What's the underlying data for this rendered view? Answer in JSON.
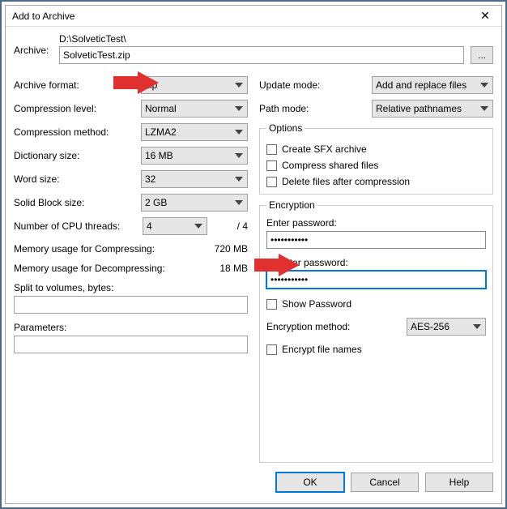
{
  "title": "Add to Archive",
  "archive": {
    "label": "Archive:",
    "path": "D:\\SolveticTest\\",
    "name": "SolveticTest.zip",
    "browse": "..."
  },
  "left": {
    "format_lbl": "Archive format:",
    "format_val": "zip",
    "level_lbl": "Compression level:",
    "level_val": "Normal",
    "method_lbl": "Compression method:",
    "method_val": "LZMA2",
    "dict_lbl": "Dictionary size:",
    "dict_val": "16 MB",
    "word_lbl": "Word size:",
    "word_val": "32",
    "block_lbl": "Solid Block size:",
    "block_val": "2 GB",
    "cpu_lbl": "Number of CPU threads:",
    "cpu_val": "4",
    "cpu_total": "/ 4",
    "mem_comp_lbl": "Memory usage for Compressing:",
    "mem_comp_val": "720 MB",
    "mem_decomp_lbl": "Memory usage for Decompressing:",
    "mem_decomp_val": "18 MB",
    "split_lbl": "Split to volumes, bytes:",
    "split_val": "",
    "params_lbl": "Parameters:",
    "params_val": ""
  },
  "right": {
    "update_lbl": "Update mode:",
    "update_val": "Add and replace files",
    "pathmode_lbl": "Path mode:",
    "pathmode_val": "Relative pathnames",
    "options_legend": "Options",
    "opt_sfx": "Create SFX archive",
    "opt_shared": "Compress shared files",
    "opt_delete": "Delete files after compression",
    "enc_legend": "Encryption",
    "enter_pw_lbl": "Enter password:",
    "enter_pw_val": "•••••••••••",
    "reenter_pw_lbl": "Reenter password:",
    "reenter_pw_val": "•••••••••••",
    "show_pw": "Show Password",
    "enc_method_lbl": "Encryption method:",
    "enc_method_val": "AES-256",
    "enc_names": "Encrypt file names"
  },
  "buttons": {
    "ok": "OK",
    "cancel": "Cancel",
    "help": "Help"
  }
}
